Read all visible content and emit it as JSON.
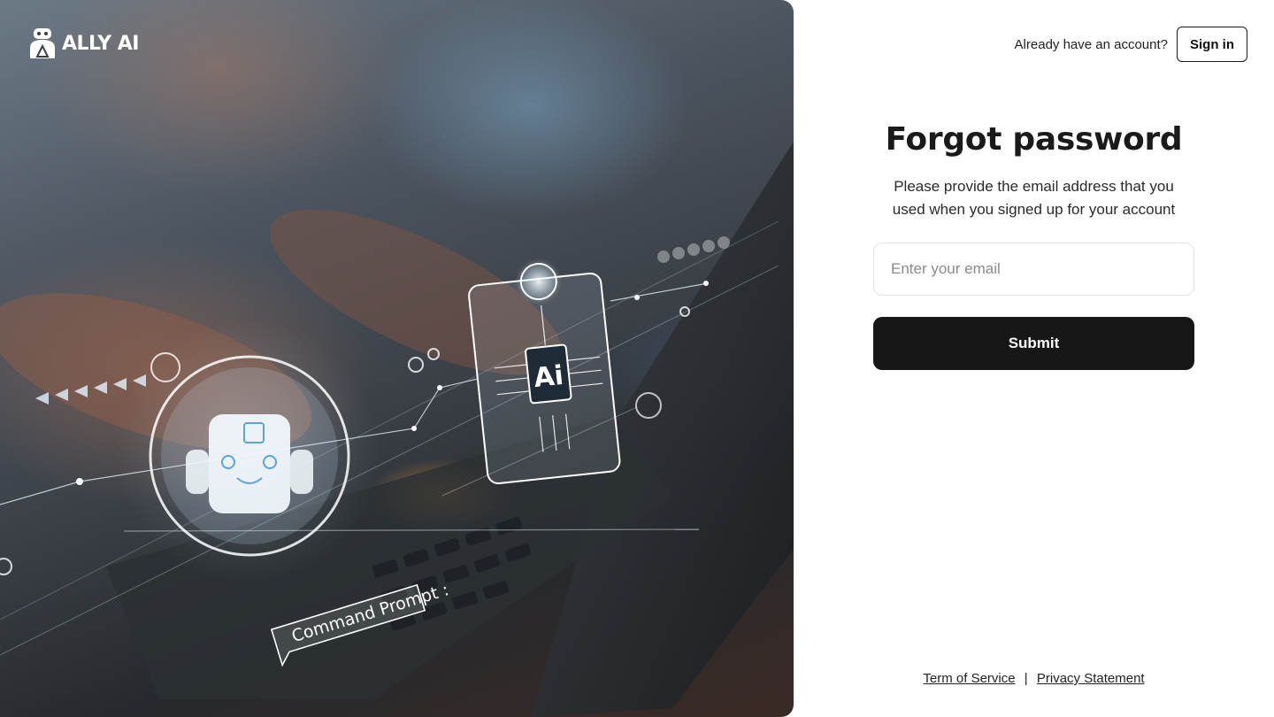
{
  "brand": {
    "name": "ALLY AI"
  },
  "hero": {
    "overlay_text": "Command Prompt :",
    "chip_label": "Ai"
  },
  "header": {
    "account_prompt": "Already have an account?",
    "signin_label": "Sign in"
  },
  "form": {
    "title": "Forgot password",
    "subtitle": "Please provide the email address that you used when you signed up for your account",
    "email_placeholder": "Enter your email",
    "email_value": "",
    "submit_label": "Submit"
  },
  "footer": {
    "terms_label": "Term of Service",
    "separator": "|",
    "privacy_label": "Privacy Statement"
  },
  "colors": {
    "primary_button": "#171717",
    "background": "#ffffff",
    "input_border": "#e2e2e2"
  }
}
